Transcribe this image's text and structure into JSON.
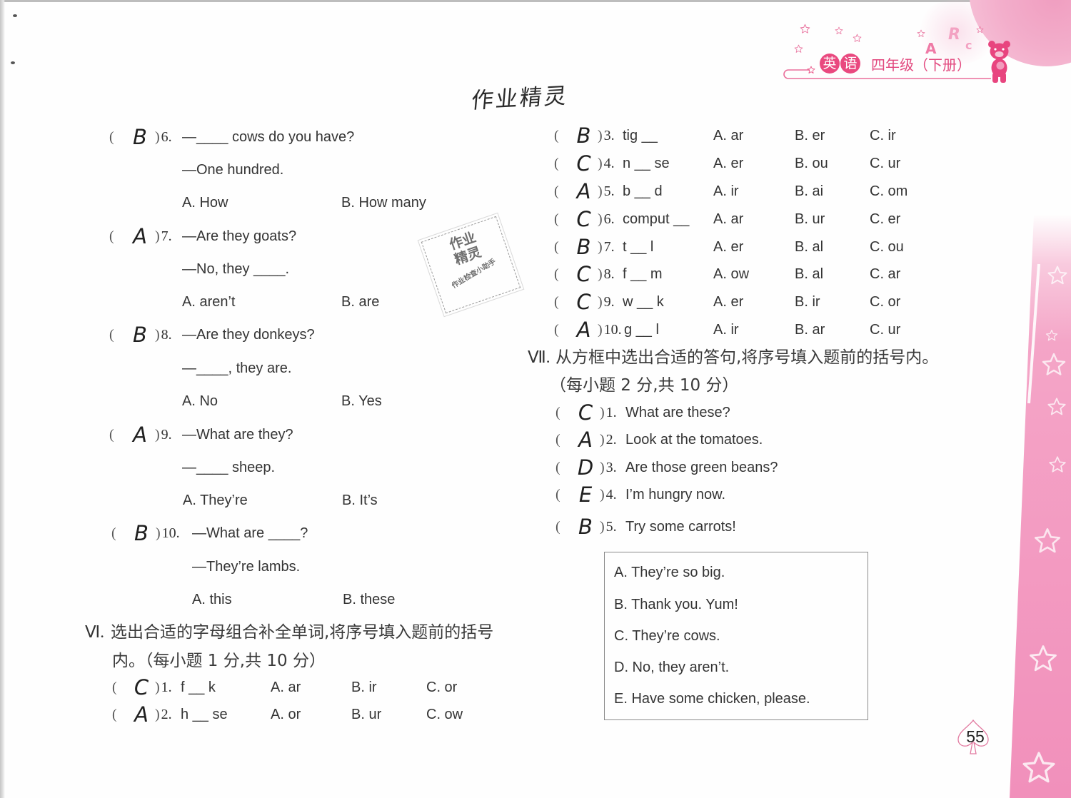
{
  "header": {
    "subject_chars": [
      "英",
      "语"
    ],
    "grade_volume": "四年级（下册）",
    "decor_letters": [
      "A",
      "R",
      "c"
    ]
  },
  "handwritten_title": "作业精灵",
  "stamp": {
    "title_line1": "作业",
    "title_line2": "精灵",
    "caption": "作业检查小助手"
  },
  "common": {
    "open_paren": "(",
    "close_paren": ")"
  },
  "section_v": {
    "questions": [
      {
        "number": "6.",
        "answer": "B",
        "prompt": "—____ cows do you have?",
        "reply": "—One hundred.",
        "options": [
          "A. How",
          "B. How many"
        ]
      },
      {
        "number": "7.",
        "answer": "A",
        "prompt": "—Are they goats?",
        "reply": "—No, they ____.",
        "options": [
          "A. aren’t",
          "B. are"
        ]
      },
      {
        "number": "8.",
        "answer": "B",
        "prompt": "—Are they donkeys?",
        "reply": "—____, they are.",
        "options": [
          "A. No",
          "B. Yes"
        ]
      },
      {
        "number": "9.",
        "answer": "A",
        "prompt": "—What are they?",
        "reply": "—____ sheep.",
        "options": [
          "A. They’re",
          "B. It’s"
        ]
      },
      {
        "number": "10.",
        "answer": "B",
        "prompt": "—What are ____?",
        "reply": "—They’re lambs.",
        "options": [
          "A. this",
          "B. these"
        ]
      }
    ]
  },
  "section_vi": {
    "label": "Ⅵ.",
    "instruction": [
      "选出合适的字母组合补全单词,将序号填入题前的括号",
      "内。（每小题 1 分,共 10 分）"
    ],
    "items": [
      {
        "number": "1.",
        "answer": "C",
        "word": "f __ k",
        "options": [
          "A. ar",
          "B. ir",
          "C. or"
        ]
      },
      {
        "number": "2.",
        "answer": "A",
        "word": "h __ se",
        "options": [
          "A. or",
          "B. ur",
          "C. ow"
        ]
      },
      {
        "number": "3.",
        "answer": "B",
        "word": "tig __",
        "options": [
          "A. ar",
          "B. er",
          "C. ir"
        ]
      },
      {
        "number": "4.",
        "answer": "C",
        "word": "n __ se",
        "options": [
          "A. er",
          "B. ou",
          "C. ur"
        ]
      },
      {
        "number": "5.",
        "answer": "A",
        "word": "b __ d",
        "options": [
          "A. ir",
          "B. ai",
          "C. om"
        ]
      },
      {
        "number": "6.",
        "answer": "C",
        "word": "comput __",
        "options": [
          "A. ar",
          "B. ur",
          "C. er"
        ]
      },
      {
        "number": "7.",
        "answer": "B",
        "word": "t __ l",
        "options": [
          "A. er",
          "B. al",
          "C. ou"
        ]
      },
      {
        "number": "8.",
        "answer": "C",
        "word": "f __ m",
        "options": [
          "A. ow",
          "B. al",
          "C. ar"
        ]
      },
      {
        "number": "9.",
        "answer": "C",
        "word": "w __ k",
        "options": [
          "A. er",
          "B. ir",
          "C. or"
        ]
      },
      {
        "number": "10.",
        "answer": "A",
        "word": "g __ l",
        "options": [
          "A. ir",
          "B. ar",
          "C. ur"
        ]
      }
    ]
  },
  "section_vii": {
    "label": "Ⅶ.",
    "instruction": [
      "从方框中选出合适的答句,将序号填入题前的括号内。",
      "（每小题 2 分,共 10 分）"
    ],
    "items": [
      {
        "number": "1.",
        "answer": "C",
        "text": "What are these?"
      },
      {
        "number": "2.",
        "answer": "A",
        "text": "Look at the tomatoes."
      },
      {
        "number": "3.",
        "answer": "D",
        "text": "Are those green beans?"
      },
      {
        "number": "4.",
        "answer": "E",
        "text": "I’m hungry now."
      },
      {
        "number": "5.",
        "answer": "B",
        "text": "Try some carrots!"
      }
    ],
    "answer_box": [
      "A. They’re so big.",
      "B. Thank you. Yum!",
      "C. They’re cows.",
      "D. No, they aren’t.",
      "E. Have some chicken, please."
    ]
  },
  "page_number": "55"
}
